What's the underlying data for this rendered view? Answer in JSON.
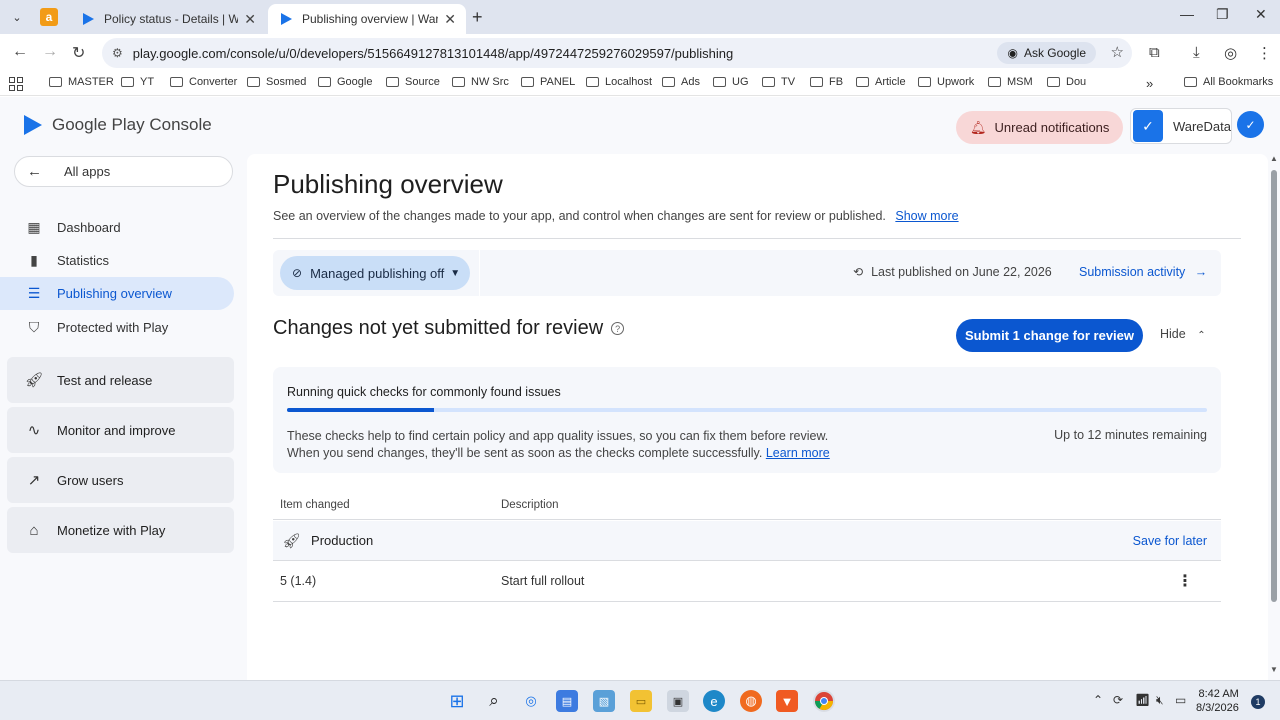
{
  "browser": {
    "tabs": [
      {
        "title": "Policy status - Details | WareDa",
        "active": false
      },
      {
        "title": "Publishing overview | WareData",
        "active": true
      }
    ],
    "url": "play.google.com/console/u/0/developers/5156649127813101448/app/4972447259276029597/publishing",
    "ask_google": "Ask Google",
    "bookmarks": [
      "MASTER",
      "YT",
      "Converter",
      "Sosmed",
      "Google",
      "Source",
      "NW Src",
      "PANEL",
      "Localhost",
      "Ads",
      "UG",
      "TV",
      "FB",
      "Article",
      "Upwork",
      "MSM",
      "Dou"
    ],
    "all_bookmarks": "All Bookmarks",
    "more_bookmarks": "»"
  },
  "header": {
    "logo_text": "Google Play Console",
    "unread_notifications": "Unread notifications",
    "app_name": "WareData"
  },
  "sidebar": {
    "all_apps": "All apps",
    "items": [
      {
        "label": "Dashboard",
        "icon": "dashboard-icon"
      },
      {
        "label": "Statistics",
        "icon": "bar-chart-icon"
      },
      {
        "label": "Publishing overview",
        "icon": "publishing-icon",
        "active": true
      },
      {
        "label": "Protected with Play",
        "icon": "shield-icon"
      }
    ],
    "groups": [
      {
        "label": "Test and release",
        "icon": "rocket-icon"
      },
      {
        "label": "Monitor and improve",
        "icon": "pulse-icon"
      },
      {
        "label": "Grow users",
        "icon": "growth-icon"
      },
      {
        "label": "Monetize with Play",
        "icon": "tag-icon"
      }
    ]
  },
  "main": {
    "title": "Publishing overview",
    "subtitle": "See an overview of the changes made to your app, and control when changes are sent for review or published.",
    "show_more": "Show more",
    "managed_publishing": "Managed publishing off",
    "last_published": "Last published on June 22, 2026",
    "submission_activity": "Submission activity",
    "changes_title": "Changes not yet submitted for review",
    "submit_button": "Submit 1 change for review",
    "hide": "Hide",
    "checks": {
      "title": "Running quick checks for commonly found issues",
      "progress": 0.16,
      "desc_line1": "These checks help to find certain policy and app quality issues, so you can fix them before review.",
      "desc_line2": "When you send changes, they'll be sent as soon as the checks complete successfully.",
      "learn_more": "Learn more",
      "remaining": "Up to 12 minutes remaining"
    },
    "table": {
      "col_item": "Item changed",
      "col_desc": "Description",
      "group_label": "Production",
      "save_for_later": "Save for later",
      "rows": [
        {
          "item": "5 (1.4)",
          "description": "Start full rollout"
        }
      ]
    }
  },
  "taskbar": {
    "time": "8:42 AM",
    "date": "8/3/2026",
    "notification_count": "1"
  },
  "colors": {
    "accent": "#0b57d0",
    "active_nav_bg": "#dce8fb",
    "unread_bg": "#f8d7d7"
  }
}
